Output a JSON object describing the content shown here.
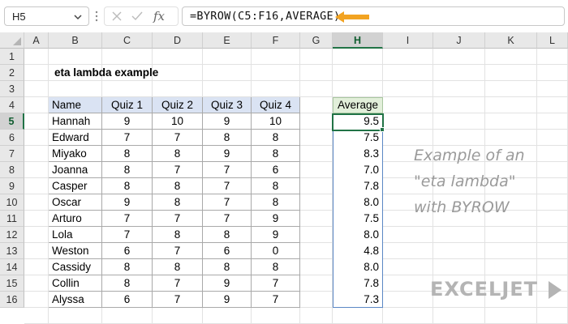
{
  "formula_bar": {
    "name_box": "H5",
    "fx_label": "fx",
    "formula": "=BYROW(C5:F16,AVERAGE)"
  },
  "grid": {
    "columns": [
      "A",
      "B",
      "C",
      "D",
      "E",
      "F",
      "G",
      "H",
      "I",
      "J",
      "K",
      "L"
    ],
    "selected_column": "H",
    "rows": [
      "1",
      "2",
      "3",
      "4",
      "5",
      "6",
      "7",
      "8",
      "9",
      "10",
      "11",
      "12",
      "13",
      "14",
      "15",
      "16"
    ],
    "selected_row": "5"
  },
  "sheet": {
    "title": "eta lambda example",
    "table": {
      "headers": [
        "Name",
        "Quiz 1",
        "Quiz 2",
        "Quiz 3",
        "Quiz 4"
      ],
      "rows": [
        [
          "Hannah",
          "9",
          "10",
          "9",
          "10"
        ],
        [
          "Edward",
          "7",
          "7",
          "8",
          "8"
        ],
        [
          "Miyako",
          "8",
          "8",
          "9",
          "8"
        ],
        [
          "Joanna",
          "8",
          "7",
          "7",
          "6"
        ],
        [
          "Casper",
          "8",
          "8",
          "7",
          "8"
        ],
        [
          "Oscar",
          "9",
          "8",
          "7",
          "8"
        ],
        [
          "Arturo",
          "7",
          "7",
          "7",
          "9"
        ],
        [
          "Lola",
          "7",
          "8",
          "8",
          "9"
        ],
        [
          "Weston",
          "6",
          "7",
          "6",
          "0"
        ],
        [
          "Cassidy",
          "8",
          "8",
          "8",
          "8"
        ],
        [
          "Collin",
          "8",
          "7",
          "9",
          "7"
        ],
        [
          "Alyssa",
          "6",
          "7",
          "9",
          "7"
        ]
      ]
    },
    "average": {
      "header": "Average",
      "values": [
        "9.5",
        "7.5",
        "8.3",
        "7.0",
        "7.8",
        "8.0",
        "7.5",
        "8.0",
        "4.8",
        "8.0",
        "7.8",
        "7.3"
      ]
    },
    "note_lines": [
      "Example of an",
      "\"eta lambda\"",
      "with BYROW"
    ]
  },
  "branding": {
    "logo_text": "EXCELJET"
  },
  "colors": {
    "accent_green": "#217346",
    "arrow_orange": "#f2a321",
    "table_header_blue": "#dae3f3",
    "average_header_green": "#e2efda",
    "selection_border_blue": "#5b87c5"
  }
}
